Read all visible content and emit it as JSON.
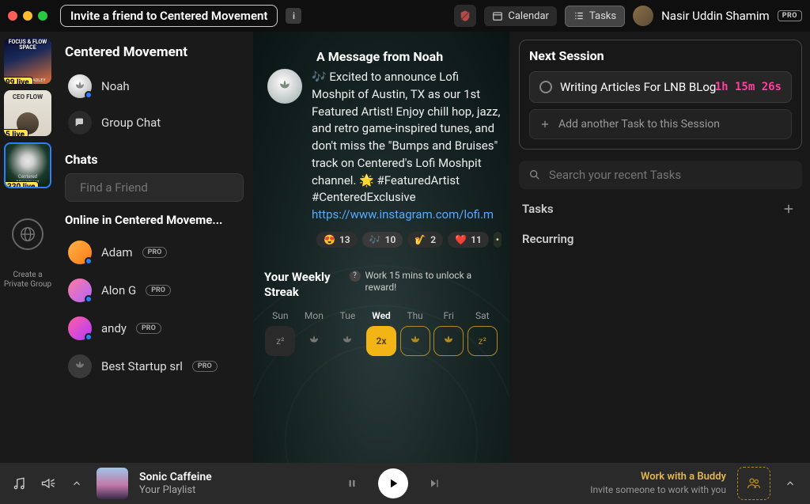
{
  "titlebar": {
    "invite": "Invite a friend to Centered Movement",
    "calendar": "Calendar",
    "tasks": "Tasks",
    "user": "Nasir Uddin Shamim",
    "pro": "PRO"
  },
  "sidestrip": {
    "focus_flow": "FOCUS & FLOW SPACE",
    "focus_flow_sub": "AUGUST BRADLEY",
    "ff_badge": "99 live",
    "ceo": "CEO FLOW",
    "ceo_badge": "5 live",
    "cm_badge": "330 live",
    "create": "Create a Private Group"
  },
  "left": {
    "group": "Centered Movement",
    "noah": "Noah",
    "groupchat": "Group Chat",
    "chats": "Chats",
    "search_placeholder": "Find a Friend",
    "online": "Online in Centered Moveme...",
    "users": [
      {
        "name": "Adam",
        "pro": "PRO"
      },
      {
        "name": "Alon G",
        "pro": "PRO"
      },
      {
        "name": "andy",
        "pro": "PRO"
      },
      {
        "name": "Best Startup srl",
        "pro": "PRO"
      }
    ]
  },
  "center": {
    "msg_title": "A Message from Noah",
    "msg_body": "🎶 Excited to announce Lofi Moshpit of Austin, TX as our 1st Featured Artist! Enjoy chill hop, jazz, and retro game-inspired tunes, and don't miss the \"Bumps and Bruises\" track on Centered's Lofi Moshpit channel. 🌟 #FeaturedArtist #CenteredExclusive",
    "msg_link": "https://www.instagram.com/lofi.m",
    "reactions": [
      {
        "emoji": "😍",
        "count": 13
      },
      {
        "emoji": "🎶",
        "count": 10
      },
      {
        "emoji": "🎷",
        "count": 2
      },
      {
        "emoji": "❤️",
        "count": 11
      }
    ],
    "streak_title": "Your Weekly Streak",
    "streak_hint": "Work 15 mins to unlock a reward!",
    "days": [
      "Sun",
      "Mon",
      "Tue",
      "Wed",
      "Thu",
      "Fri",
      "Sat"
    ],
    "wed_badge": "2x"
  },
  "right": {
    "next_session": "Next Session",
    "task": "Writing Articles For LNB BLog",
    "timer": "1h 15m 26s",
    "add_task": "Add another Task to this Session",
    "search_placeholder": "Search your recent Tasks",
    "tasks_section": "Tasks",
    "recurring_section": "Recurring"
  },
  "player": {
    "track": "Sonic Caffeine",
    "playlist": "Your Playlist",
    "buddy_title": "Work with a Buddy",
    "buddy_sub": "Invite someone to work with you"
  }
}
